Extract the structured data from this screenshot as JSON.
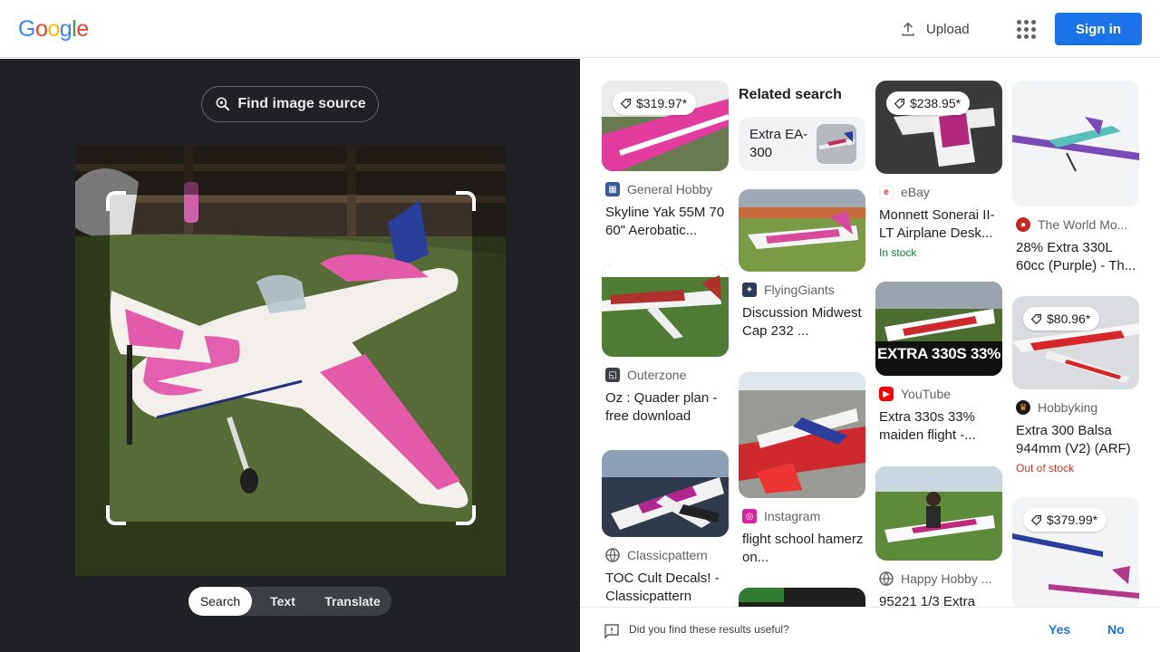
{
  "header": {
    "logo_letters": [
      "G",
      "o",
      "o",
      "g",
      "l",
      "e"
    ],
    "logo_colors": [
      "#4285f4",
      "#ea4335",
      "#fbbc05",
      "#4285f4",
      "#34a853",
      "#ea4335"
    ],
    "upload_label": "Upload",
    "signin_label": "Sign in"
  },
  "left": {
    "find_source_label": "Find image source",
    "modes": [
      "Search",
      "Text",
      "Translate"
    ],
    "active_mode": "Search"
  },
  "results": {
    "related_title": "Related search",
    "related_chip": "Extra EA-300",
    "cards": [
      {
        "price": "$319.97*",
        "source": "General Hobby",
        "title": "Skyline Yak 55M 70 60\" Aerobatic...",
        "favicon": "grid-icon"
      },
      {
        "price": "",
        "source": "Outerzone",
        "title": "Oz : Quader plan - free download",
        "favicon": "outerzone-icon"
      },
      {
        "price": "",
        "source": "Classicpattern",
        "title": "TOC Cult Decals! - Classicpattern",
        "favicon": "globe-icon"
      },
      {
        "price": "",
        "source": "FlyingGiants",
        "title": "Discussion Midwest Cap 232 ...",
        "favicon": "flyinggiants-icon"
      },
      {
        "price": "",
        "source": "Instagram",
        "title": "flight school hamerz on...",
        "favicon": "instagram-icon"
      },
      {
        "price": "$238.95*",
        "source": "eBay",
        "title": "Monnett Sonerai II-LT Airplane Desk...",
        "stock": "In stock",
        "favicon": "ebay-icon"
      },
      {
        "price": "",
        "source": "YouTube",
        "title": "Extra 330s 33% maiden flight -...",
        "favicon": "youtube-icon",
        "overlay": "EXTRA 330S 33%"
      },
      {
        "price": "",
        "source": "Happy Hobby ...",
        "title": "95221 1/3 Extra",
        "favicon": "globe-icon"
      },
      {
        "price": "",
        "source": "The World Mo...",
        "title": "28% Extra 330L 60cc (Purple) - Th...",
        "favicon": "world-icon"
      },
      {
        "price": "$80.96*",
        "source": "Hobbyking",
        "title": "Extra 300 Balsa 944mm (V2) (ARF)",
        "stock": "Out of stock",
        "favicon": "hobbyking-icon"
      },
      {
        "price": "$379.99*",
        "source": "",
        "title": "",
        "favicon": ""
      }
    ]
  },
  "feedback": {
    "question": "Did you find these results useful?",
    "yes": "Yes",
    "no": "No"
  }
}
